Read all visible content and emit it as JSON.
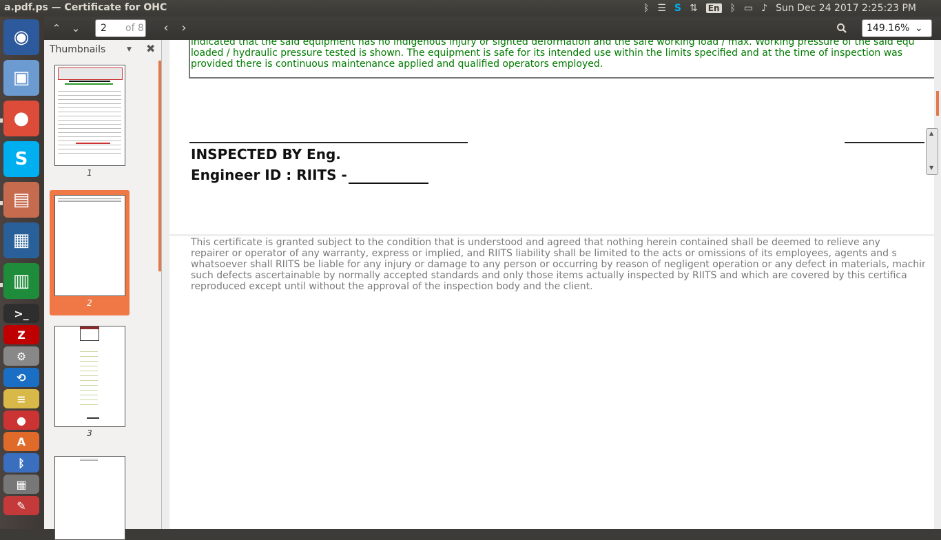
{
  "window": {
    "title": "a.pdf.ps — Certificate for OHC"
  },
  "panel": {
    "language": "En",
    "clock": "Sun Dec 24 2017  2:25:23 PM",
    "tray_icons": [
      "bluetooth-icon",
      "list-icon",
      "skype-icon",
      "network-updown-icon",
      "keyboard-language",
      "bluetooth-icon",
      "battery-icon",
      "volume-icon"
    ]
  },
  "launcher": {
    "items": [
      {
        "name": "ubuntu-dash",
        "glyph": "◉",
        "color": "#2c5a9c"
      },
      {
        "name": "virtualbox",
        "glyph": "▣",
        "color": "#6c9bd2"
      },
      {
        "name": "chrome",
        "glyph": "●",
        "color": "#dd4b39"
      },
      {
        "name": "skype",
        "glyph": "S",
        "color": "#00aff0"
      },
      {
        "name": "files",
        "glyph": "▤",
        "color": "#c76b4e"
      },
      {
        "name": "libreoffice-impress",
        "glyph": "▦",
        "color": "#2a6099"
      },
      {
        "name": "libreoffice-calc",
        "glyph": "▥",
        "color": "#1e8c3a"
      },
      {
        "name": "terminal",
        "glyph": ">_",
        "color": "#2e2e2e"
      },
      {
        "name": "filezilla",
        "glyph": "Z",
        "color": "#bf0000"
      },
      {
        "name": "settings",
        "glyph": "⚙",
        "color": "#888888"
      },
      {
        "name": "sync",
        "glyph": "⟲",
        "color": "#1a6fc4"
      },
      {
        "name": "notes",
        "glyph": "≡",
        "color": "#d9b84a"
      },
      {
        "name": "app-red",
        "glyph": "●",
        "color": "#cc3333"
      },
      {
        "name": "app-orange",
        "glyph": "A",
        "color": "#e06a2a"
      },
      {
        "name": "bluetooth",
        "glyph": "ᛒ",
        "color": "#3a6fc0"
      },
      {
        "name": "calculator",
        "glyph": "▦",
        "color": "#777777"
      },
      {
        "name": "document-viewer",
        "glyph": "✎",
        "color": "#c43a3a"
      }
    ]
  },
  "toolbar": {
    "page_current": "2",
    "page_total": "of 8",
    "zoom": "149.16%"
  },
  "sidebar": {
    "title": "Thumbnails",
    "thumbnails": [
      {
        "label": "1",
        "selected": false
      },
      {
        "label": "2",
        "selected": true
      },
      {
        "label": "3",
        "selected": false
      },
      {
        "label": "",
        "selected": false
      }
    ]
  },
  "document": {
    "green_lines": [
      "indicated that the said equipment has no indigenous injury or sighted deformation and the safe working load / max. Working pressure of the said equ",
      "loaded / hydraulic pressure tested is shown.  The equipment is safe for its intended use within the limits specified and at the time of inspection was",
      "provided there is continuous maintenance applied and qualified operators employed."
    ],
    "inspected_by": "INSPECTED BY Eng.",
    "engineer_id": "Engineer ID : RIITS -",
    "disclaimer_lines": [
      "This certificate is granted  subject  to the condition  that  is  understood and  agreed  that nothing herein contained  shall  be deemed to  relieve any",
      "repairer or operator of any warranty, express or implied, and RIITS liability shall be limited to the acts or omissions of its employees, agents and s",
      "whatsoever shall RIITS be liable for any injury or damage to any person or occurring by reason of negligent operation or any defect in materials, machin",
      "such defects ascertainable by normally accepted standards and only those items actually inspected by RIITS and which are covered by this certifica",
      "reproduced except until without the approval of the inspection body and the client."
    ]
  },
  "colors": {
    "accent": "#f07746",
    "green_text": "#007a00",
    "grey_text": "#7a7a7a"
  }
}
